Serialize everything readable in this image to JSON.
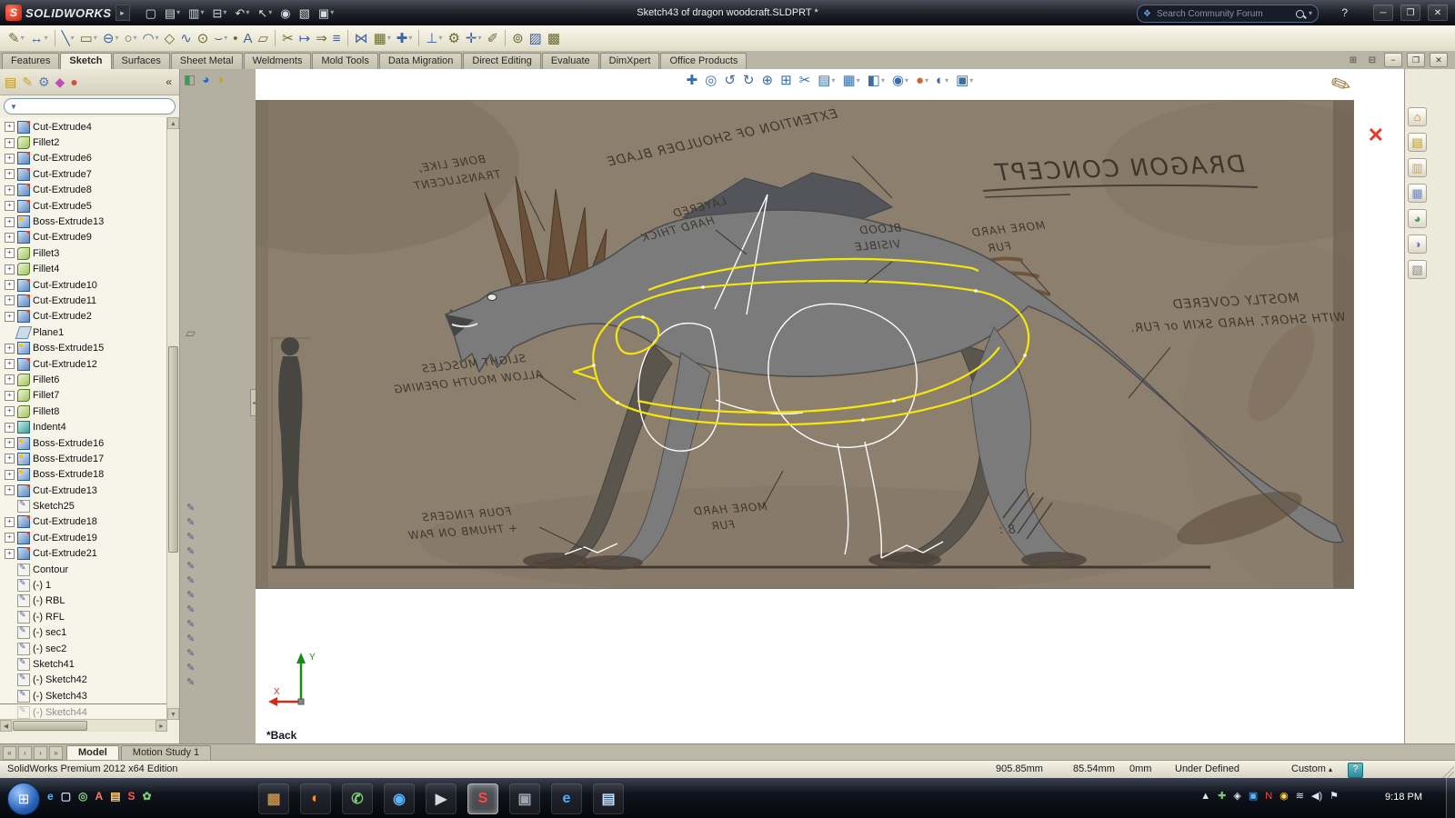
{
  "titlebar": {
    "brand": "SOLIDWORKS",
    "title": "Sketch43 of dragon woodcraft.SLDPRT *",
    "search_placeholder": "Search Community Forum",
    "icons": [
      {
        "name": "new-document-icon",
        "glyph": "▢"
      },
      {
        "name": "open-document-icon",
        "glyph": "▤",
        "dd": true
      },
      {
        "name": "save-icon",
        "glyph": "▥",
        "dd": true
      },
      {
        "name": "print-icon",
        "glyph": "⊟",
        "dd": true
      },
      {
        "name": "undo-icon",
        "glyph": "↶",
        "dd": true
      },
      {
        "name": "select-icon",
        "glyph": "↖",
        "dd": true
      },
      {
        "name": "record-macro-icon",
        "glyph": "◉"
      },
      {
        "name": "file-properties-icon",
        "glyph": "▧"
      },
      {
        "name": "options-icon",
        "glyph": "▣",
        "dd": true
      }
    ]
  },
  "icons": {
    "dropdown": "▾",
    "plus": "+",
    "help": "?",
    "minimize": "─",
    "maximize": "❐",
    "close": "✕",
    "doc_minimize": "−",
    "doc_restore": "❐",
    "doc_close": "✕",
    "pane_a": "⊞",
    "pane_b": "⊟",
    "collapse": "«",
    "filter": "▼",
    "splitter": "◂",
    "up": "▲",
    "down": "▼",
    "left": "◀",
    "right": "►",
    "orb": "⊞",
    "config_arrow": "▴",
    "bubble": "❖"
  },
  "sketch_toolbar": [
    {
      "name": "sketch-icon",
      "glyph": "✎",
      "dd": true
    },
    {
      "name": "smart-dimension-icon",
      "glyph": "↔",
      "dd": true
    },
    {
      "name": "toolbar-separator",
      "glyph": "",
      "cls": "sep"
    },
    {
      "name": "line-icon",
      "glyph": "╲",
      "dd": true
    },
    {
      "name": "corner-rectangle-icon",
      "glyph": "▭",
      "dd": true
    },
    {
      "name": "straight-slot-icon",
      "glyph": "⊖",
      "dd": true
    },
    {
      "name": "circle-icon",
      "glyph": "○",
      "dd": true
    },
    {
      "name": "centerpoint-arc-icon",
      "glyph": "◠",
      "dd": true
    },
    {
      "name": "polygon-icon",
      "glyph": "◇"
    },
    {
      "name": "spline-icon",
      "glyph": "∿"
    },
    {
      "name": "ellipse-icon",
      "glyph": "⊙"
    },
    {
      "name": "sketch-fillet-icon",
      "glyph": "⌣",
      "dd": true
    },
    {
      "name": "point-icon",
      "glyph": "•"
    },
    {
      "name": "text-icon",
      "glyph": "A"
    },
    {
      "name": "plane-icon",
      "glyph": "▱"
    },
    {
      "name": "toolbar-separator",
      "glyph": "",
      "cls": "sep"
    },
    {
      "name": "trim-entities-icon",
      "glyph": "✂"
    },
    {
      "name": "extend-entities-icon",
      "glyph": "↦"
    },
    {
      "name": "convert-entities-icon",
      "glyph": "⇒"
    },
    {
      "name": "offset-entities-icon",
      "glyph": "≡"
    },
    {
      "name": "toolbar-separator",
      "glyph": "",
      "cls": "sep"
    },
    {
      "name": "mirror-entities-icon",
      "glyph": "⋈"
    },
    {
      "name": "linear-sketch-pattern-icon",
      "glyph": "▦",
      "dd": true
    },
    {
      "name": "move-entities-icon",
      "glyph": "✚",
      "dd": true
    },
    {
      "name": "toolbar-separator",
      "glyph": "",
      "cls": "sep"
    },
    {
      "name": "display-relations-icon",
      "glyph": "⊥",
      "dd": true
    },
    {
      "name": "repair-sketch-icon",
      "glyph": "⚙"
    },
    {
      "name": "quick-snaps-icon",
      "glyph": "✛",
      "dd": true
    },
    {
      "name": "rapid-sketch-icon",
      "glyph": "✐"
    },
    {
      "name": "toolbar-separator",
      "glyph": "",
      "cls": "sep"
    },
    {
      "name": "instant2d-icon",
      "glyph": "⊚"
    },
    {
      "name": "sketch-picture-icon",
      "glyph": "▨"
    },
    {
      "name": "shaded-contours-icon",
      "glyph": "▩"
    }
  ],
  "command_tabs": [
    {
      "label": "Features",
      "name": "tab-features"
    },
    {
      "label": "Sketch",
      "name": "tab-sketch",
      "cls": "active"
    },
    {
      "label": "Surfaces",
      "name": "tab-surfaces"
    },
    {
      "label": "Sheet Metal",
      "name": "tab-sheet-metal"
    },
    {
      "label": "Weldments",
      "name": "tab-weldments"
    },
    {
      "label": "Mold Tools",
      "name": "tab-mold-tools"
    },
    {
      "label": "Data Migration",
      "name": "tab-data-migration"
    },
    {
      "label": "Direct Editing",
      "name": "tab-direct-editing"
    },
    {
      "label": "Evaluate",
      "name": "tab-evaluate"
    },
    {
      "label": "DimXpert",
      "name": "tab-dimxpert"
    },
    {
      "label": "Office Products",
      "name": "tab-office-products"
    }
  ],
  "panel": {
    "tabs": [
      {
        "name": "featuremanager-tab-icon",
        "glyph": "▤",
        "color": "#b8962a"
      },
      {
        "name": "propertymanager-tab-icon",
        "glyph": "✎",
        "color": "#caa21e"
      },
      {
        "name": "configurationmanager-tab-icon",
        "glyph": "⚙",
        "color": "#5a7ab8"
      },
      {
        "name": "dimxpertmanager-tab-icon",
        "glyph": "◆",
        "color": "#c84ab8"
      },
      {
        "name": "displaymanager-tab-icon",
        "glyph": "●",
        "color": "#d8503a"
      }
    ],
    "tree": [
      {
        "label": "Cut-Extrude4",
        "icon": "ic-ce",
        "exp": true
      },
      {
        "label": "Fillet2",
        "icon": "ic-fl",
        "exp": true
      },
      {
        "label": "Cut-Extrude6",
        "icon": "ic-ce",
        "exp": true
      },
      {
        "label": "Cut-Extrude7",
        "icon": "ic-ce",
        "exp": true
      },
      {
        "label": "Cut-Extrude8",
        "icon": "ic-ce",
        "exp": true
      },
      {
        "label": "Cut-Extrude5",
        "icon": "ic-ce",
        "exp": true
      },
      {
        "label": "Boss-Extrude13",
        "icon": "ic-be",
        "exp": true
      },
      {
        "label": "Cut-Extrude9",
        "icon": "ic-ce",
        "exp": true
      },
      {
        "label": "Fillet3",
        "icon": "ic-fl",
        "exp": true
      },
      {
        "label": "Fillet4",
        "icon": "ic-fl",
        "exp": true
      },
      {
        "label": "Cut-Extrude10",
        "icon": "ic-ce",
        "exp": true
      },
      {
        "label": "Cut-Extrude11",
        "icon": "ic-ce",
        "exp": true
      },
      {
        "label": "Cut-Extrude2",
        "icon": "ic-ce",
        "exp": true
      },
      {
        "label": "Plane1",
        "icon": "ic-pl",
        "exp": false
      },
      {
        "label": "Boss-Extrude15",
        "icon": "ic-be",
        "exp": true
      },
      {
        "label": "Cut-Extrude12",
        "icon": "ic-ce",
        "exp": true
      },
      {
        "label": "Fillet6",
        "icon": "ic-fl",
        "exp": true
      },
      {
        "label": "Fillet7",
        "icon": "ic-fl",
        "exp": true
      },
      {
        "label": "Fillet8",
        "icon": "ic-fl",
        "exp": true
      },
      {
        "label": "Indent4",
        "icon": "ic-in",
        "exp": true
      },
      {
        "label": "Boss-Extrude16",
        "icon": "ic-be",
        "exp": true
      },
      {
        "label": "Boss-Extrude17",
        "icon": "ic-be",
        "exp": true
      },
      {
        "label": "Boss-Extrude18",
        "icon": "ic-be",
        "exp": true
      },
      {
        "label": "Cut-Extrude13",
        "icon": "ic-ce",
        "exp": true
      },
      {
        "label": "Sketch25",
        "icon": "ic-sk",
        "exp": false
      },
      {
        "label": "Cut-Extrude18",
        "icon": "ic-ce",
        "exp": true
      },
      {
        "label": "Cut-Extrude19",
        "icon": "ic-ce",
        "exp": true
      },
      {
        "label": "Cut-Extrude21",
        "icon": "ic-ce",
        "exp": true
      },
      {
        "label": "Contour",
        "icon": "ic-sk",
        "exp": false
      },
      {
        "label": "(-) 1",
        "icon": "ic-sk",
        "exp": false
      },
      {
        "label": "(-) RBL",
        "icon": "ic-sk",
        "exp": false
      },
      {
        "label": "(-) RFL",
        "icon": "ic-sk",
        "exp": false
      },
      {
        "label": "(-) sec1",
        "icon": "ic-sk",
        "exp": false
      },
      {
        "label": "(-) sec2",
        "icon": "ic-sk",
        "exp": false
      },
      {
        "label": "Sketch41",
        "icon": "ic-sk",
        "exp": false
      },
      {
        "label": "(-) Sketch42",
        "icon": "ic-sk",
        "exp": false
      },
      {
        "label": "(-) Sketch43",
        "icon": "ic-sk",
        "exp": false
      },
      {
        "label": "(-) Sketch44",
        "icon": "ic-sk",
        "exp": false,
        "cls": "dim"
      }
    ]
  },
  "strip": {
    "icons": [
      {
        "name": "selection-filter-icon",
        "glyph": "◧",
        "color": "#3a9a5a"
      },
      {
        "name": "display-settings-icon",
        "glyph": "◕",
        "color": "#2a6ac0"
      },
      {
        "name": "appearance-ball-icon",
        "glyph": "◑",
        "color": "#d0a020"
      }
    ],
    "marks": [
      "✎",
      "✎",
      "✎",
      "✎",
      "✎",
      "✎",
      "✎",
      "✎",
      "✎",
      "✎",
      "✎",
      "✎",
      "✎"
    ]
  },
  "viewport": {
    "headsup": [
      {
        "name": "pan-icon",
        "glyph": "✚"
      },
      {
        "name": "zoom-to-fit-icon",
        "glyph": "◎"
      },
      {
        "name": "previous-view-icon",
        "glyph": "↺"
      },
      {
        "name": "refresh-view-icon",
        "glyph": "↻"
      },
      {
        "name": "zoom-in-icon",
        "glyph": "⊕"
      },
      {
        "name": "zoom-area-icon",
        "glyph": "⊞"
      },
      {
        "name": "section-view-icon",
        "glyph": "✂"
      },
      {
        "name": "annotations-icon",
        "glyph": "▤",
        "dd": true
      },
      {
        "name": "view-orientation-icon",
        "glyph": "▦",
        "dd": true
      },
      {
        "name": "display-style-icon",
        "glyph": "◧",
        "dd": true
      },
      {
        "name": "hide-show-icon",
        "glyph": "◉",
        "dd": true
      },
      {
        "name": "edit-appearance-icon",
        "glyph": "●",
        "dd": true,
        "color": "#c86a2a"
      },
      {
        "name": "apply-scene-icon",
        "glyph": "◐",
        "dd": true
      },
      {
        "name": "view-settings-icon",
        "glyph": "▣",
        "dd": true
      }
    ],
    "view_name": "*Back",
    "triad": {
      "x": "X",
      "y": "Y"
    },
    "annotations": {
      "shoulder": "EXTENTION OF SHOULDER BLADE",
      "bone1": "BONE LIKE,",
      "bone2": "TRANSLUCENT",
      "layered1": "LAYERED",
      "layered2": "HARD THICK",
      "blood1": "BLOOD",
      "blood2": "VISIBLE",
      "fur_top1": "MORE HARD",
      "fur_top2": "FUR",
      "title": "DRAGON CONCEPT",
      "covered1": "MOSTLY COVERED",
      "covered2": "WITH SHORT, HARD SKIN or FUR.",
      "muscles1": "SLIGHT MUSCLES",
      "muscles2": "ALLOW MOUTH OPENING",
      "fingers1": "FOUR FINGERS",
      "fingers2": "+ THUMB ON PAW",
      "fur_rear1": "MORE HARD",
      "fur_rear2": "FUR",
      "eight": "8 :"
    }
  },
  "taskpane": [
    {
      "name": "task-pane-home-icon",
      "glyph": "⌂",
      "color": "#c8762a"
    },
    {
      "name": "design-library-icon",
      "glyph": "▤",
      "color": "#b89a3a"
    },
    {
      "name": "file-explorer-icon",
      "glyph": "▥",
      "color": "#caa84e"
    },
    {
      "name": "view-palette-icon",
      "glyph": "▦",
      "color": "#6a88b8"
    },
    {
      "name": "appearances-icon",
      "glyph": "◕",
      "color": "#4a9a5a"
    },
    {
      "name": "scenes-icon",
      "glyph": "◑",
      "color": "#8a6ab8"
    },
    {
      "name": "custom-properties-icon",
      "glyph": "▧",
      "color": "#8a8a8a"
    }
  ],
  "doc_tabs": {
    "nav": [
      "«",
      "‹",
      "›",
      "»"
    ],
    "tabs": [
      {
        "label": "Model",
        "name": "tab-model",
        "cls": "active"
      },
      {
        "label": "Motion Study 1",
        "name": "tab-motion-study-1"
      }
    ]
  },
  "statusbar": {
    "edition": "SolidWorks Premium 2012 x64 Edition",
    "x": "905.85mm",
    "y": "85.54mm",
    "z": "0mm",
    "state": "Under Defined",
    "config": "Custom"
  },
  "taskbar": {
    "quick": [
      {
        "name": "quick-launch-ie-icon",
        "glyph": "e",
        "color": "#5ab4ff"
      },
      {
        "name": "quick-launch-desktop-icon",
        "glyph": "▢",
        "color": "#cfd8e8"
      },
      {
        "name": "quick-launch-media-icon",
        "glyph": "◎",
        "color": "#8ad08a"
      },
      {
        "name": "quick-launch-writer-icon",
        "glyph": "A",
        "color": "#ff7a5a"
      },
      {
        "name": "quick-launch-folder-icon",
        "glyph": "▤",
        "color": "#ffd27a"
      },
      {
        "name": "quick-launch-sw-icon",
        "glyph": "S",
        "color": "#ff5a4a"
      },
      {
        "name": "quick-launch-leaf-icon",
        "glyph": "✿",
        "color": "#7ad06a"
      }
    ],
    "apps": [
      {
        "name": "taskbar-app-1",
        "glyph": "▩",
        "color": "#c08a4a"
      },
      {
        "name": "taskbar-app-2",
        "glyph": "◐",
        "color": "#ff8a2a"
      },
      {
        "name": "taskbar-app-3",
        "glyph": "✆",
        "color": "#7ad07a"
      },
      {
        "name": "taskbar-app-4",
        "glyph": "◉",
        "color": "#5ab4ff"
      },
      {
        "name": "taskbar-app-5",
        "glyph": "▶",
        "color": "#d8d8e0"
      },
      {
        "name": "taskbar-app-solidworks",
        "glyph": "S",
        "color": "#ff4a3a",
        "cls": "active"
      },
      {
        "name": "taskbar-app-7",
        "glyph": "▣",
        "color": "#9aa4b0"
      },
      {
        "name": "taskbar-app-8",
        "glyph": "e",
        "color": "#4ab0ff"
      },
      {
        "name": "taskbar-app-9",
        "glyph": "▤",
        "color": "#bfe0ff"
      }
    ],
    "tray": [
      {
        "name": "tray-expand-icon",
        "glyph": "▲",
        "color": "#dfe6f0"
      },
      {
        "name": "tray-icon-1",
        "glyph": "✚",
        "color": "#7ad07a"
      },
      {
        "name": "tray-icon-2",
        "glyph": "◈",
        "color": "#dfe6f0"
      },
      {
        "name": "tray-icon-3",
        "glyph": "▣",
        "color": "#5ab4ff"
      },
      {
        "name": "tray-icon-4",
        "glyph": "N",
        "color": "#ff4a3a"
      },
      {
        "name": "tray-icon-5",
        "glyph": "◉",
        "color": "#ffd24a"
      },
      {
        "name": "tray-network-icon",
        "glyph": "≋",
        "color": "#dfe6f0"
      },
      {
        "name": "tray-volume-icon",
        "glyph": "◀)",
        "color": "#dfe6f0"
      },
      {
        "name": "tray-flag-icon",
        "glyph": "⚑",
        "color": "#dfe6f0"
      }
    ],
    "clock": "9:18 PM"
  }
}
